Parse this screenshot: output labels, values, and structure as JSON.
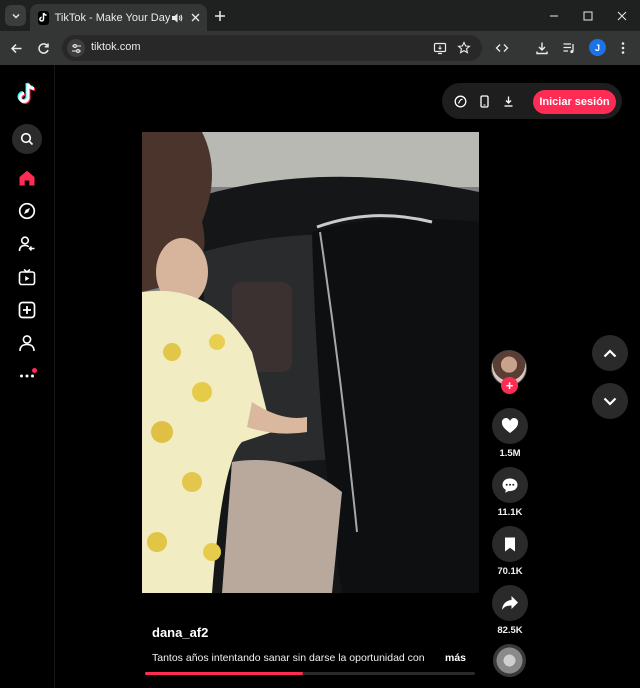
{
  "browser": {
    "tab_title": "TikTok - Make Your Day",
    "url": "tiktok.com",
    "profile_initial": "J"
  },
  "header": {
    "login_label": "Iniciar sesión"
  },
  "video": {
    "username": "dana_af2",
    "caption": "Tantos años intentando sanar sin darse la oportunidad con",
    "more_label": "más",
    "progress": 0.48
  },
  "actions": {
    "likes": "1.5M",
    "comments": "11.1K",
    "saves": "70.1K",
    "shares": "82.5K"
  },
  "colors": {
    "accent": "#fe2c55",
    "background": "#000000"
  }
}
